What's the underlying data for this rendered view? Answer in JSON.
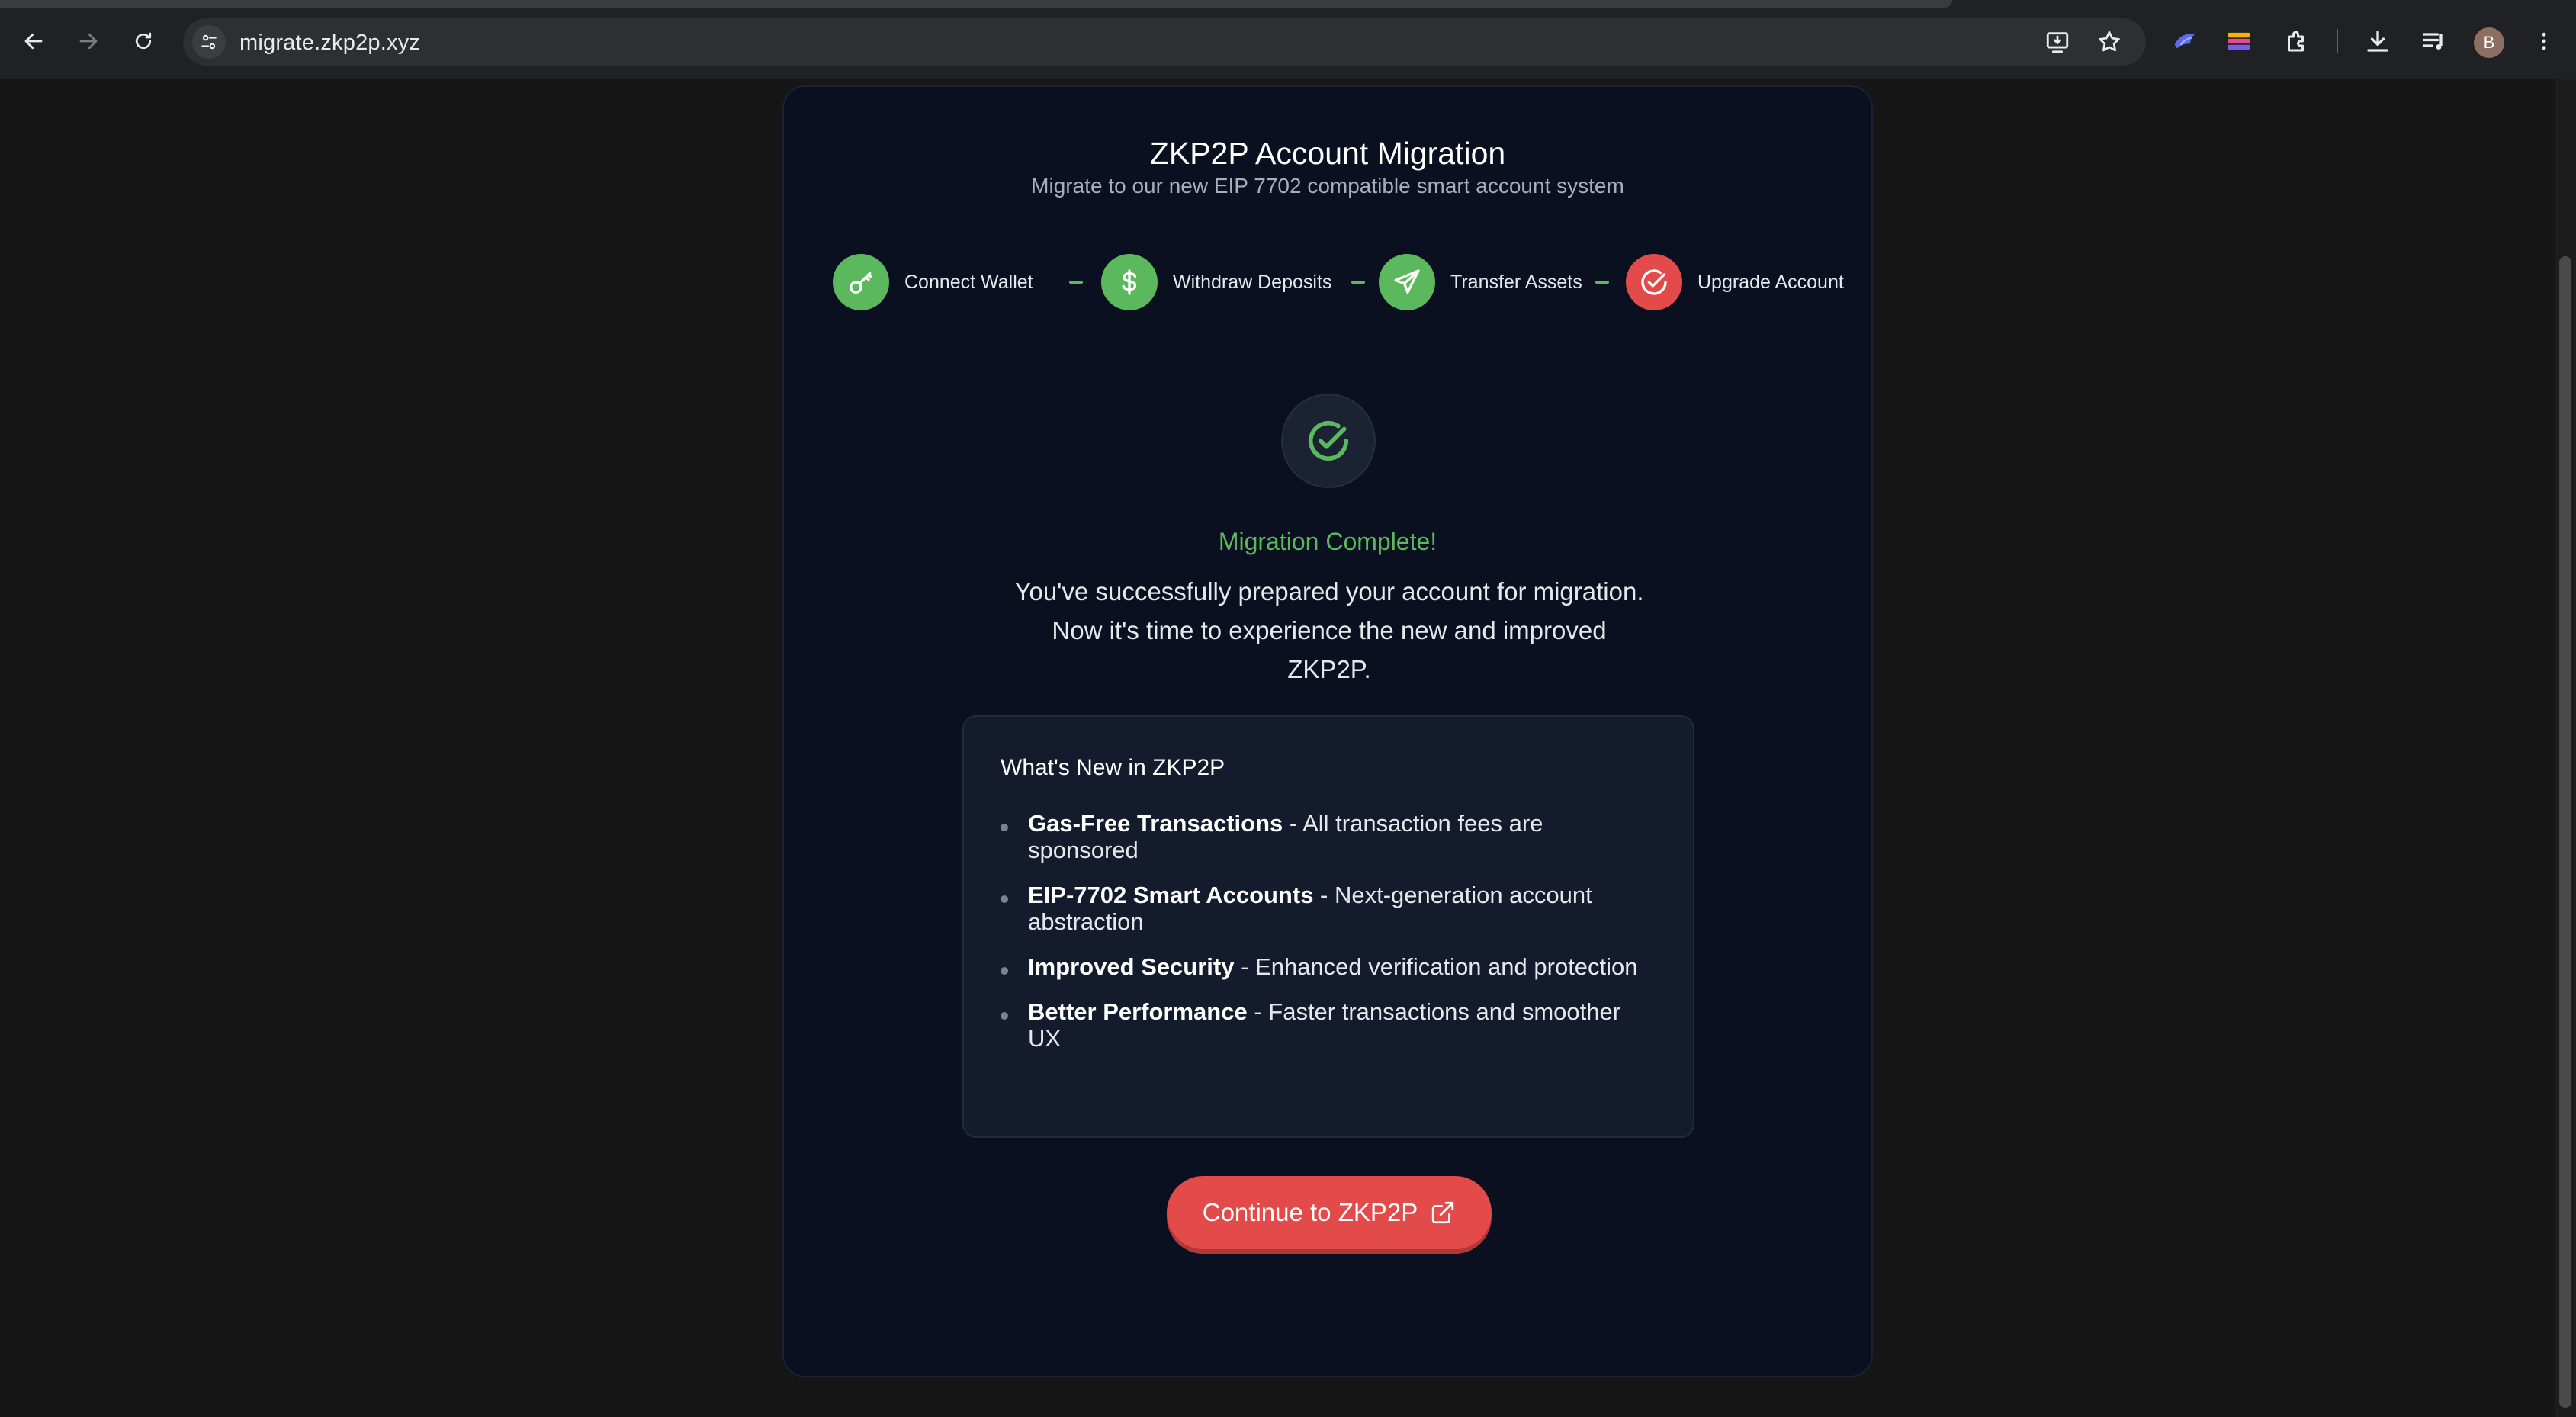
{
  "browser": {
    "url": "migrate.zkp2p.xyz",
    "profile_initial": "B"
  },
  "card": {
    "title": "ZKP2P Account Migration",
    "subtitle": "Migrate to our new EIP 7702 compatible smart account system",
    "steps": [
      {
        "label": "Connect Wallet",
        "icon": "key-icon",
        "color": "#5cb85c"
      },
      {
        "label": "Withdraw Deposits",
        "icon": "dollar-icon",
        "color": "#5cb85c"
      },
      {
        "label": "Transfer Assets",
        "icon": "send-icon",
        "color": "#5cb85c"
      },
      {
        "label": "Upgrade Account",
        "icon": "check-circle-icon",
        "color": "#e34a4a"
      }
    ],
    "status_title": "Migration Complete!",
    "status_description": "You've successfully prepared your account for migration. Now it's time to experience the new and improved ZKP2P.",
    "whats_new": {
      "title": "What's New in ZKP2P",
      "items": [
        {
          "bold": "Gas-Free Transactions",
          "text": " - All transaction fees are sponsored"
        },
        {
          "bold": "EIP-7702 Smart Accounts",
          "text": " - Next-generation account abstraction"
        },
        {
          "bold": "Improved Security",
          "text": " - Enhanced verification and protection"
        },
        {
          "bold": "Better Performance",
          "text": " - Faster transactions and smoother UX"
        }
      ]
    },
    "cta_label": "Continue to ZKP2P"
  },
  "colors": {
    "success": "#5cb85c",
    "accent": "#e34a4a",
    "card_bg": "#0b1020"
  }
}
